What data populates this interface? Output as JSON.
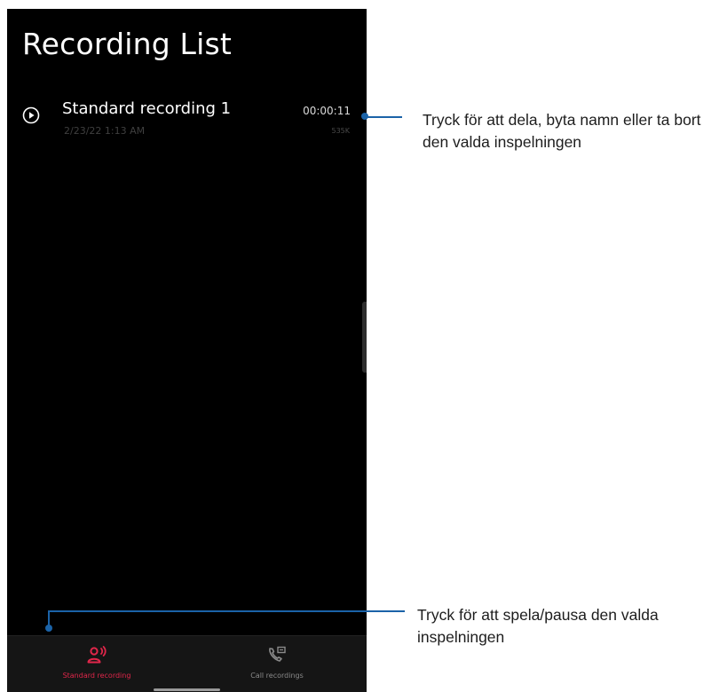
{
  "app": {
    "title": "Recording List"
  },
  "recordings": [
    {
      "name": "Standard recording 1",
      "date": "2/23/22 1:13 AM",
      "duration": "00:00:11",
      "size": "535K",
      "icon": "play-circle-icon"
    }
  ],
  "bottom_nav": {
    "tabs": [
      {
        "label": "Standard recording",
        "icon": "microphone-person-icon",
        "active": true
      },
      {
        "label": "Call recordings",
        "icon": "phone-recording-icon",
        "active": false
      }
    ]
  },
  "callouts": [
    {
      "text": "Tryck för att dela, byta namn eller ta bort den valda inspelningen"
    },
    {
      "text": "Tryck för att spela/pausa den valda inspelningen"
    }
  ],
  "colors": {
    "screen_background": "#000000",
    "nav_background": "#151515",
    "active_tab": "#e0264a",
    "inactive_tab": "#8a8a8a",
    "callout_line": "#1b63a8"
  }
}
